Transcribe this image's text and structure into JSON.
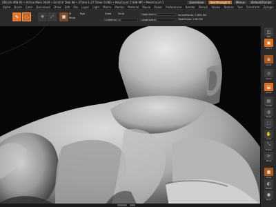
{
  "titlebar": {
    "title": "ZBrush 4R8 P2 • Active Mem 3029 • Scratch Disk 88 • ZTime 1.27 Timer 0.083 • PolyCount 2.608 MP • MeshCount 1",
    "quicksave": "QuickSave",
    "see_through": "See-through 0",
    "menus": "Menus",
    "default_zscript": "DefaultZScript"
  },
  "menubar": {
    "items": [
      "Alpha",
      "Brush",
      "Color",
      "Document",
      "Draw",
      "Edit",
      "File",
      "Layer",
      "Light",
      "Macro",
      "Marker",
      "Material",
      "Movie",
      "Picker",
      "Preferences",
      "Render",
      "Stencil",
      "Stroke",
      "Texture",
      "Tool",
      "Transform",
      "Zplugin",
      "Zscript",
      "Help"
    ]
  },
  "toolbar": {
    "m_label": "M",
    "mrgb_label": "Mrgb",
    "rgb_label": "Rgb",
    "zadd_label": "Zadd",
    "zsub_label": "Zsub",
    "focal_shift": "Focal Shift 0",
    "rgb_intensity": "Rgb Intensity 100",
    "z_intensity": "Z Intensity 25",
    "draw_size": "Draw Size 64",
    "active_points": "ActivePoints: 2.608 Mil",
    "total_points": "TotalPoints: 2.62 Mil",
    "z_intensity_value": 25,
    "draw_size_value": 64,
    "focal_shift_value": 0,
    "rgb_intensity_value": 100
  },
  "rightbar": {
    "labels": [
      "BPR",
      "SPix 3",
      "Scroll",
      "Zoom",
      "Actual",
      "AAHalf",
      "Persp",
      "Floor",
      "Local",
      "Frame",
      "Move",
      "Scale",
      "Rotate",
      "PolyF",
      "Transp",
      "Solo",
      "Xpose"
    ]
  },
  "colors": {
    "accent_orange": "#e3762a",
    "ui_dark": "#2b2b2b",
    "canvas_bg": "#060606",
    "model_light": "#d9d9d9",
    "model_shadow": "#6c6c6c"
  }
}
